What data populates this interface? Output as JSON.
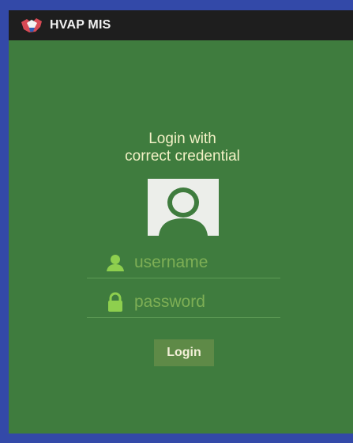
{
  "app": {
    "title": "HVAP MIS",
    "logo_icon": "app-logo-icon"
  },
  "login": {
    "heading_line1": "Login with",
    "heading_line2": "correct credential",
    "avatar_icon": "user-avatar-icon",
    "username": {
      "icon": "person-icon",
      "placeholder": "username",
      "value": ""
    },
    "password": {
      "icon": "lock-icon",
      "placeholder": "password",
      "value": ""
    },
    "button_label": "Login"
  },
  "colors": {
    "frame": "#3349a8",
    "screen_background": "#3f7c3e",
    "appbar": "#1e1e1e",
    "accent_green": "#8ecf4e",
    "button": "#5e8a47"
  }
}
